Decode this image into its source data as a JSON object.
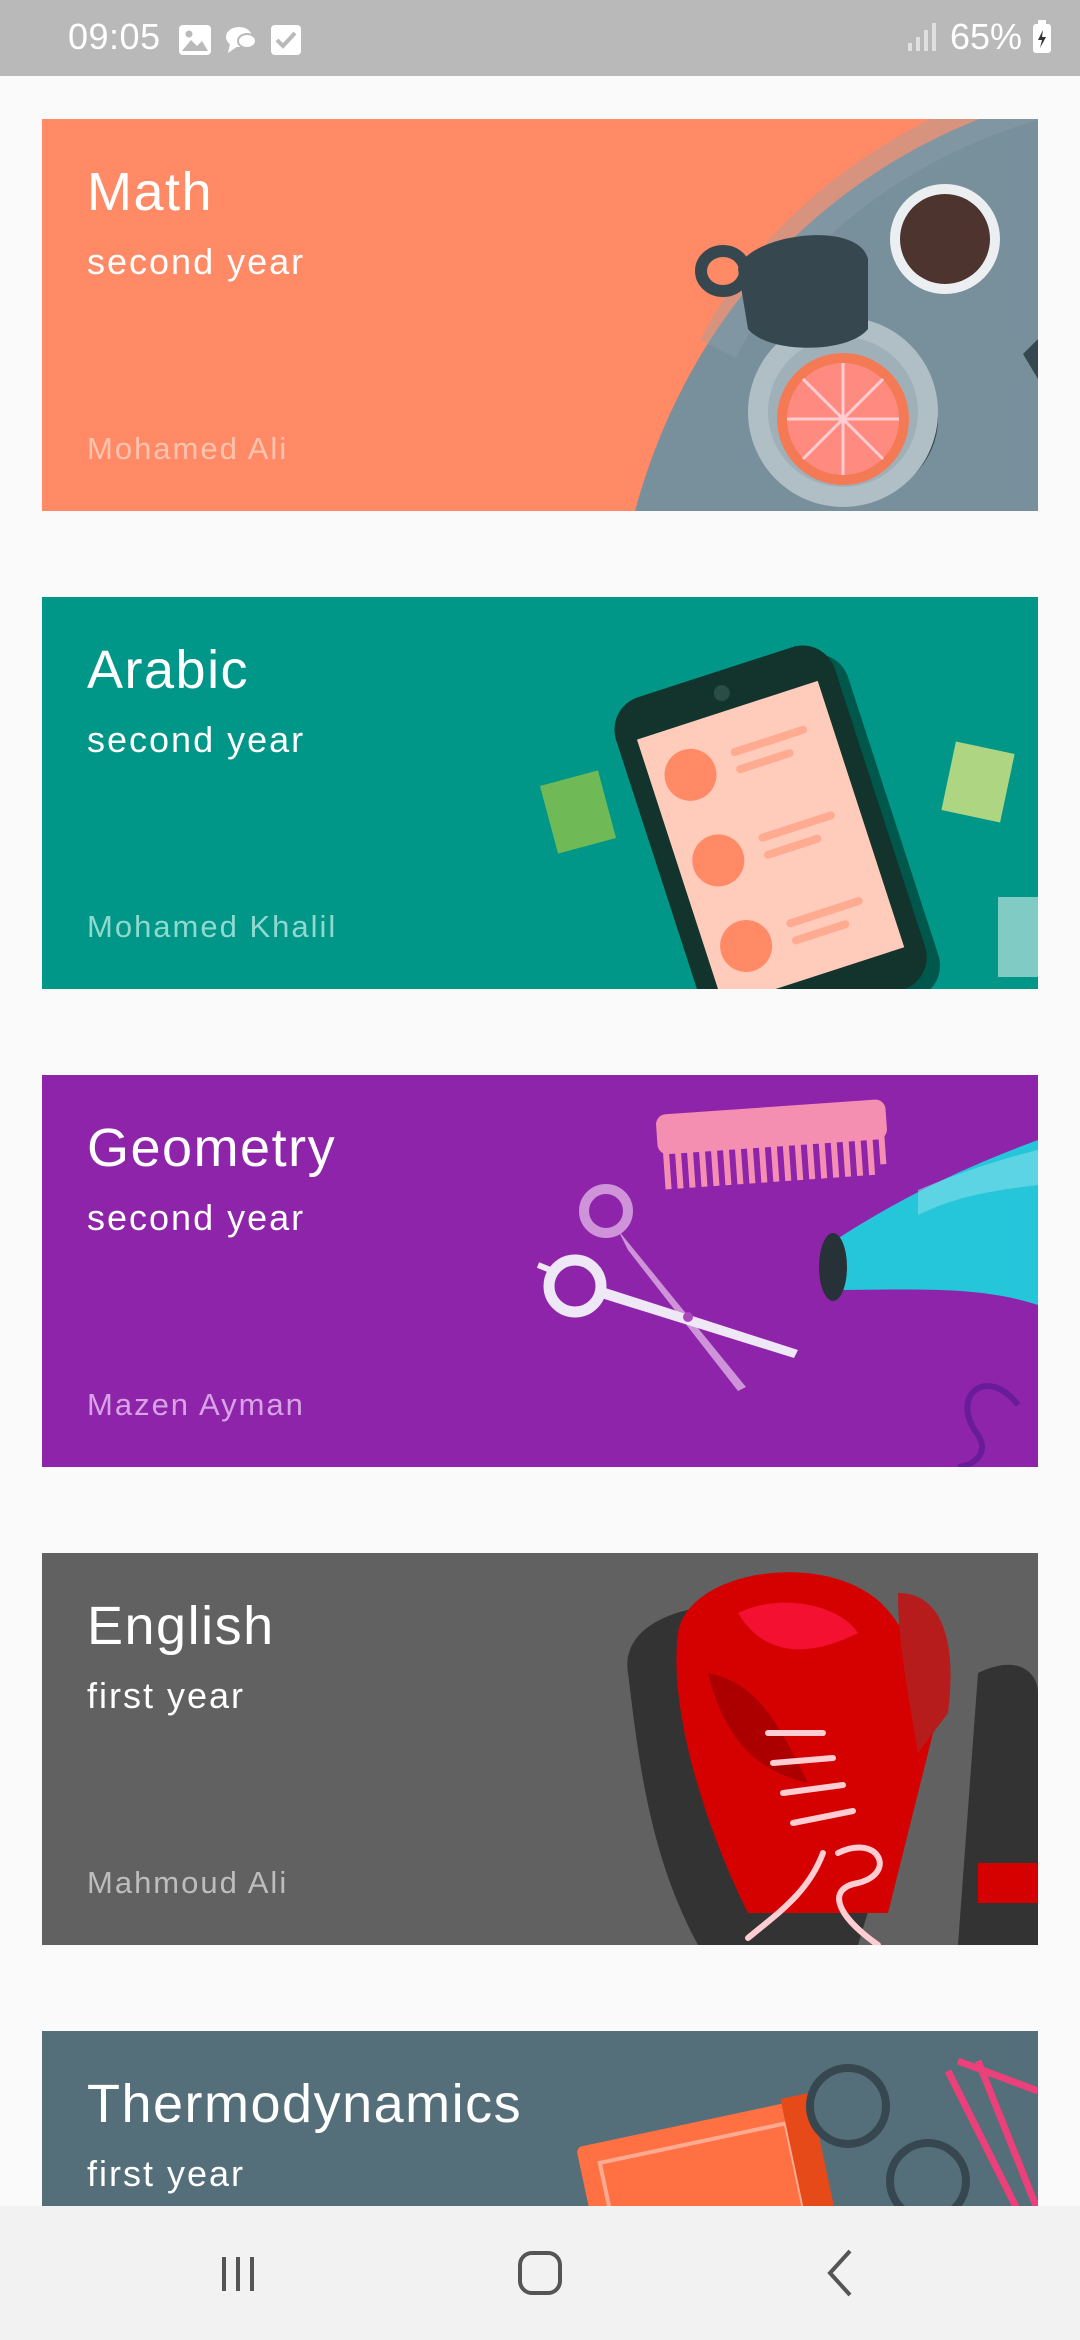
{
  "status_bar": {
    "time": "09:05",
    "battery": "65%",
    "notification_icons": [
      "gallery-icon",
      "chat-bubble-icon",
      "checkbox-icon"
    ],
    "signal_icon": "signal-icon",
    "battery_icon": "battery-icon"
  },
  "courses": [
    {
      "title": "Math",
      "subtitle": "second year",
      "teacher": "Mohamed Ali",
      "color": "#ff8a65",
      "teacher_color": "#ffc4b0",
      "illustration": "coffee-table-icon"
    },
    {
      "title": "Arabic",
      "subtitle": "second year",
      "teacher": "Mohamed Khalil",
      "color": "#009688",
      "teacher_color": "#8fd9cf",
      "illustration": "phone-contacts-icon"
    },
    {
      "title": "Geometry",
      "subtitle": "second year",
      "teacher": "Mazen Ayman",
      "color": "#8e24aa",
      "teacher_color": "#d7a3e6",
      "illustration": "scissors-comb-dryer-icon"
    },
    {
      "title": "English",
      "subtitle": "first year",
      "teacher": "Mahmoud Ali",
      "color": "#616161",
      "teacher_color": "#bdbdbd",
      "illustration": "boxing-gloves-icon"
    },
    {
      "title": "Thermodynamics",
      "subtitle": "first year",
      "teacher": "",
      "color": "#546e7a",
      "teacher_color": "#b0bec5",
      "illustration": "book-glasses-icon"
    }
  ],
  "nav_bar": {
    "recent_apps_icon": "recent-apps-icon",
    "home_icon": "home-icon",
    "back_icon": "back-icon"
  }
}
